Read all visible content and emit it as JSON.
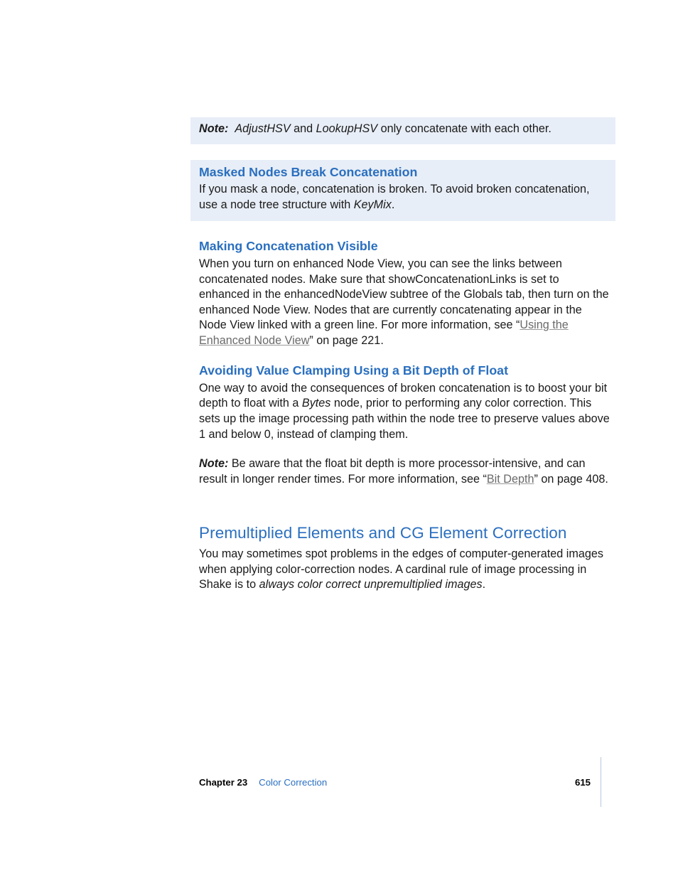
{
  "note1": {
    "prefix": "Note:",
    "seg1": "AdjustHSV",
    "mid": " and ",
    "seg2": "LookupHSV",
    "tail": " only concatenate with each other."
  },
  "masked": {
    "heading": "Masked Nodes Break Concatenation",
    "p_a": "If you mask a node, concatenation is broken. To avoid broken concatenation, use a node tree structure with ",
    "p_i": "KeyMix",
    "p_b": "."
  },
  "making": {
    "heading": "Making Concatenation Visible",
    "p_a": "When you turn on enhanced Node View, you can see the links between concatenated nodes. Make sure that showConcatenationLinks is set to enhanced in the enhancedNodeView subtree of the Globals tab, then turn on the enhanced Node View. Nodes that are currently concatenating appear in the Node View linked with a green line. For more information, see “",
    "link": "Using the Enhanced Node View",
    "p_b": "” on page 221."
  },
  "avoiding": {
    "heading": "Avoiding Value Clamping Using a Bit Depth of Float",
    "p1_a": "One way to avoid the consequences of broken concatenation is to boost your bit depth to float with a ",
    "p1_i": "Bytes",
    "p1_b": " node, prior to performing any color correction. This sets up the image processing path within the node tree to preserve values above 1 and below 0, instead of clamping them."
  },
  "note2": {
    "prefix": "Note:",
    "p_a": "  Be aware that the float bit depth is more processor-intensive, and can result in longer render times. For more information, see “",
    "link": "Bit Depth",
    "p_b": "” on page 408."
  },
  "premult": {
    "heading": "Premultiplied Elements and CG Element Correction",
    "p_a": "You may sometimes spot problems in the edges of computer-generated images when applying color-correction nodes. A cardinal rule of image processing in Shake is to ",
    "p_i": "always color correct unpremultiplied images",
    "p_b": "."
  },
  "footer": {
    "chapter_label": "Chapter 23",
    "chapter_title": "Color Correction",
    "page": "615"
  }
}
